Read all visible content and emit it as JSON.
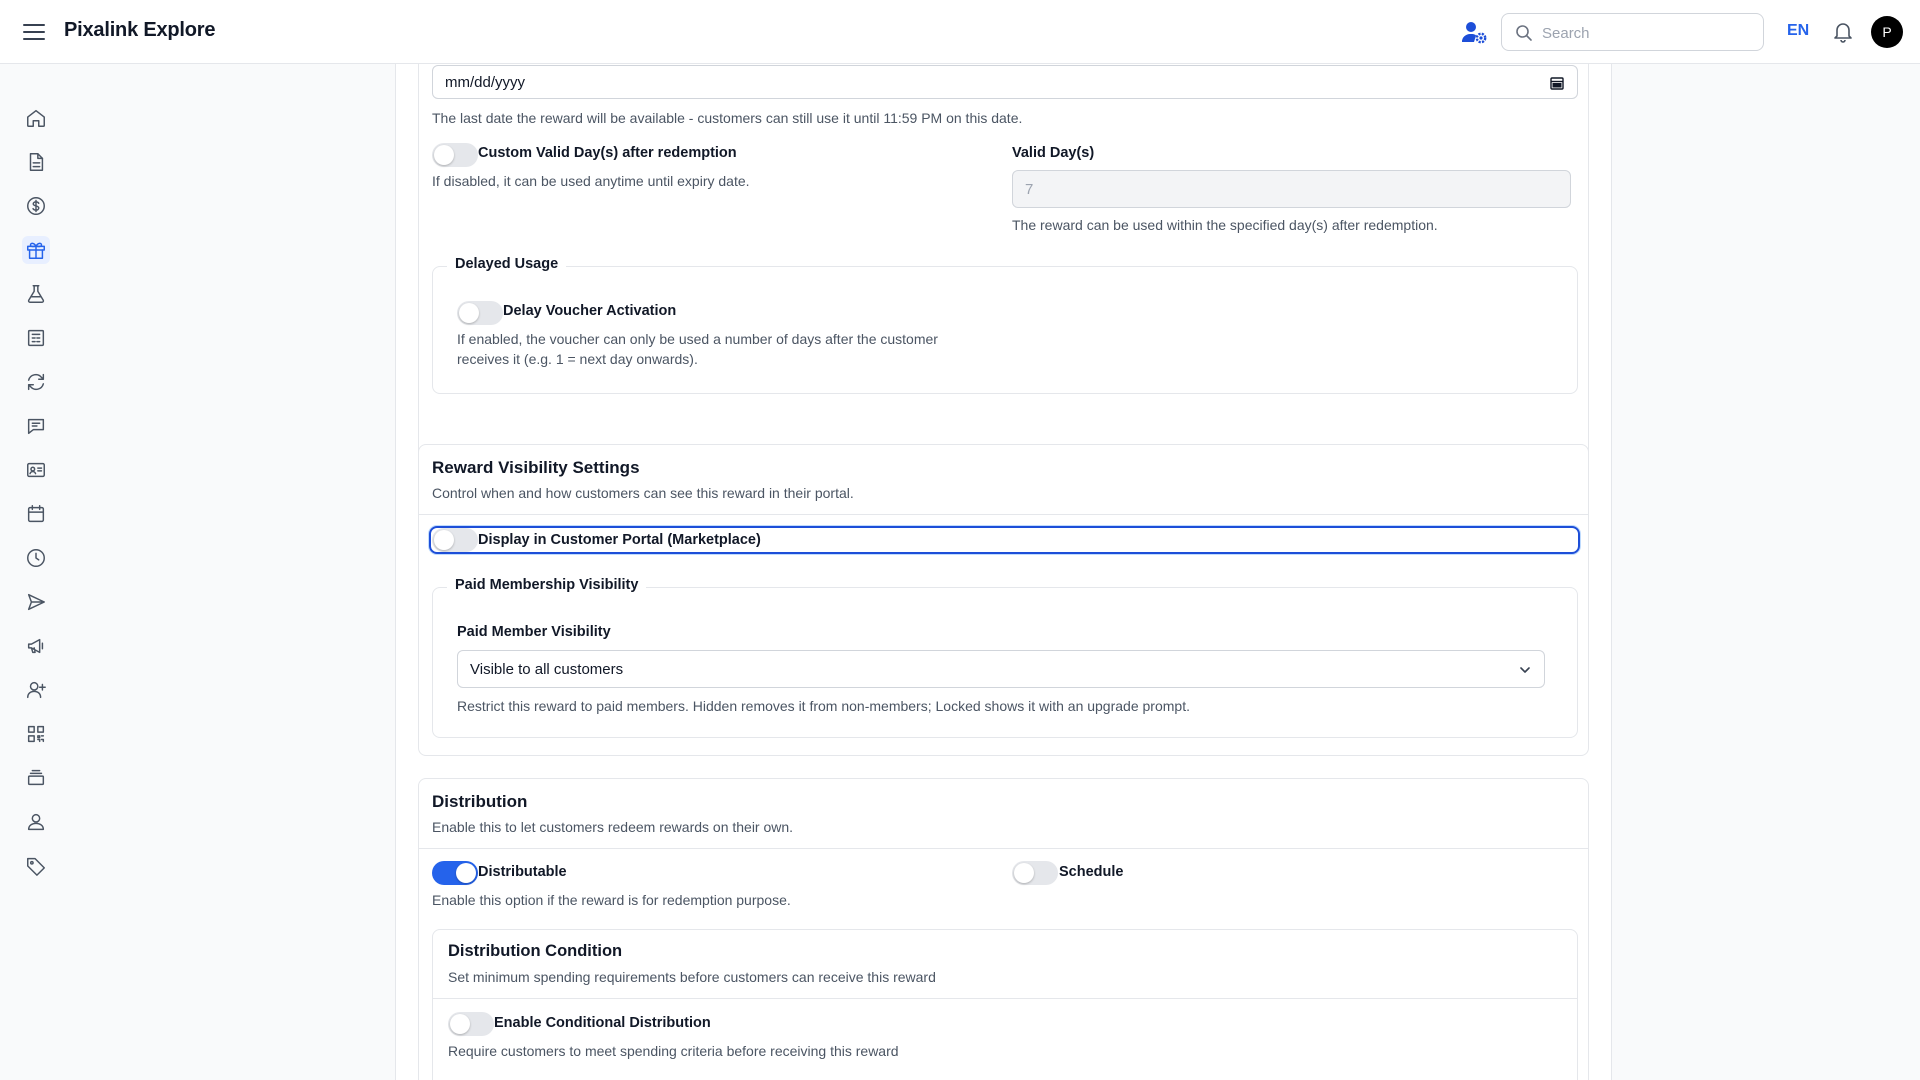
{
  "header": {
    "app_title": "Pixalink Explore",
    "search_placeholder": "Search",
    "language": "EN",
    "avatar_initial": "P"
  },
  "sidebar": {
    "items": [
      {
        "icon": "home-icon"
      },
      {
        "icon": "document-icon"
      },
      {
        "icon": "dollar-icon"
      },
      {
        "icon": "gift-icon",
        "active": true
      },
      {
        "icon": "flask-icon"
      },
      {
        "icon": "newspaper-icon"
      },
      {
        "icon": "refresh-icon"
      },
      {
        "icon": "chat-icon"
      },
      {
        "icon": "id-card-icon"
      },
      {
        "icon": "calendar-icon"
      },
      {
        "icon": "clock-icon"
      },
      {
        "icon": "send-icon"
      },
      {
        "icon": "megaphone-icon"
      },
      {
        "icon": "user-plus-icon"
      },
      {
        "icon": "qr-code-icon"
      },
      {
        "icon": "stack-icon"
      },
      {
        "icon": "user-icon"
      },
      {
        "icon": "tag-icon"
      }
    ]
  },
  "validity": {
    "date_value": "mm/dd/yyyy",
    "date_hint": "The last date the reward will be available - customers can still use it until 11:59 PM on this date.",
    "custom_valid_label": "Custom Valid Day(s) after redemption",
    "custom_valid_hint": "If disabled, it can be used anytime until expiry date.",
    "valid_days_label": "Valid Day(s)",
    "valid_days_value": "7",
    "valid_days_hint": "The reward can be used within the specified day(s) after redemption.",
    "delayed_legend": "Delayed Usage",
    "delay_label": "Delay Voucher Activation",
    "delay_hint_1": "If enabled, the voucher can only be used a number of days after the customer",
    "delay_hint_2": "receives it (e.g. 1 = next day onwards)."
  },
  "visibility": {
    "title": "Reward Visibility Settings",
    "subtitle": "Control when and how customers can see this reward in their portal.",
    "display_label": "Display in Customer Portal (Marketplace)",
    "paid_legend": "Paid Membership Visibility",
    "paid_label": "Paid Member Visibility",
    "paid_value": "Visible to all customers",
    "paid_hint": "Restrict this reward to paid members. Hidden removes it from non-members; Locked shows it with an upgrade prompt."
  },
  "distribution": {
    "title": "Distribution",
    "subtitle": "Enable this to let customers redeem rewards on their own.",
    "distributable_label": "Distributable",
    "distributable_on": true,
    "distributable_hint": "Enable this option if the reward is for redemption purpose.",
    "schedule_label": "Schedule",
    "condition_title": "Distribution Condition",
    "condition_subtitle": "Set minimum spending requirements before customers can receive this reward",
    "conditional_label": "Enable Conditional Distribution",
    "conditional_hint": "Require customers to meet spending criteria before receiving this reward"
  },
  "colors": {
    "accent": "#2563eb",
    "focus_ring": "#1d4ed8"
  }
}
